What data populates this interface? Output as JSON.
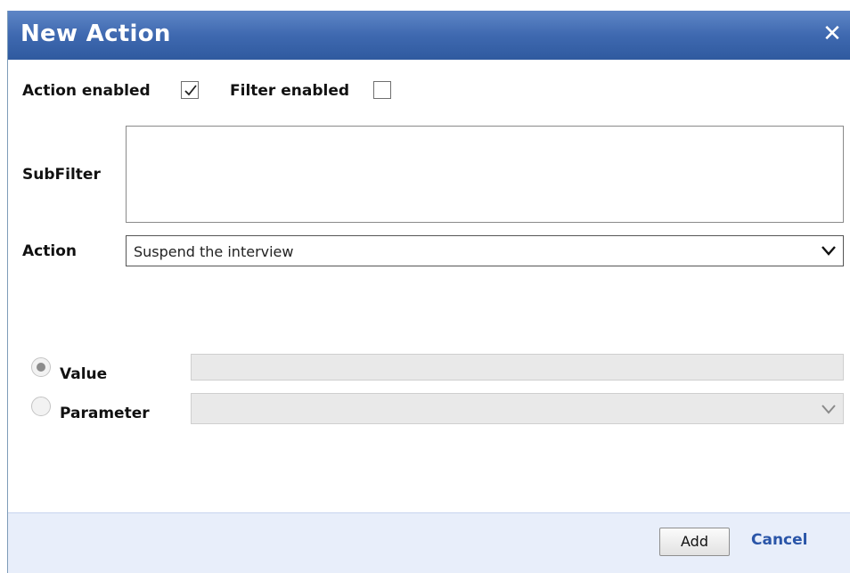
{
  "dialog": {
    "title": "New Action",
    "close_glyph": "✕"
  },
  "options": {
    "action_enabled_label": "Action enabled",
    "action_enabled_checked": true,
    "filter_enabled_label": "Filter enabled",
    "filter_enabled_checked": false
  },
  "subfilter": {
    "label": "SubFilter",
    "value": ""
  },
  "action": {
    "label": "Action",
    "selected": "Suspend the interview"
  },
  "value_source": {
    "selected": "value",
    "value_label": "Value",
    "value_text": "",
    "parameter_label": "Parameter",
    "parameter_selected": ""
  },
  "footer": {
    "add_label": "Add",
    "cancel_label": "Cancel"
  },
  "colors": {
    "titlebar": "#3f69b0",
    "footer_bg": "#e8eefa",
    "link": "#2a55a8"
  }
}
